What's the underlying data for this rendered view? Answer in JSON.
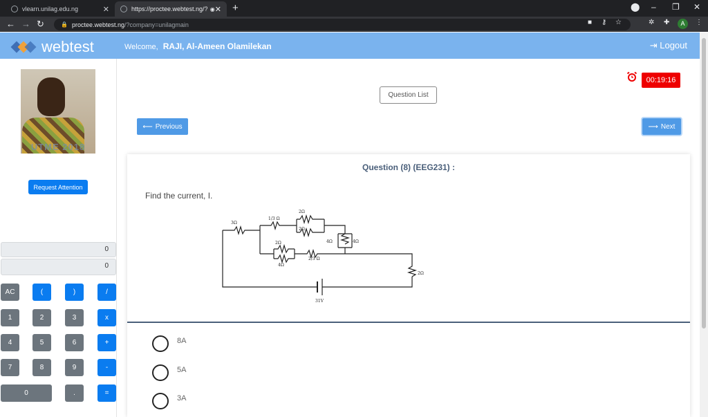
{
  "browser": {
    "tabs": [
      {
        "title": "vlearn.unilag.edu.ng",
        "active": false
      },
      {
        "title": "https://proctee.webtest.ng/?",
        "active": true
      }
    ],
    "url_host": "proctee.webtest.ng",
    "url_path": "/?company=unilagmain",
    "profile_initial": "A"
  },
  "header": {
    "brand": "webtest",
    "welcome_label": "Welcome,",
    "user_name": "RAJI, Al-Ameen Olamilekan",
    "logout_label": "Logout",
    "accent_color": "#7ab3ee"
  },
  "sidebar": {
    "photo_stamp": "UTME 2018",
    "request_attention_label": "Request Attention",
    "calculator": {
      "display_top": "0",
      "display_bottom": "0",
      "keys": {
        "ac": "AC",
        "lparen": "(",
        "rparen": ")",
        "divide": "/",
        "k1": "1",
        "k2": "2",
        "k3": "3",
        "multiply": "x",
        "k4": "4",
        "k5": "5",
        "k6": "6",
        "plus": "+",
        "k7": "7",
        "k8": "8",
        "k9": "9",
        "minus": "-",
        "k0": "0",
        "dot": ".",
        "equals": "="
      }
    }
  },
  "exam": {
    "timer": "00:19:16",
    "question_list_label": "Question List",
    "previous_label": "Previous",
    "next_label": "Next",
    "question_title": "Question (8) (EEG231) :",
    "question_text": "Find the current, I.",
    "circuit_labels": {
      "r_left": "3Ω",
      "r_third": "1/3 Ω",
      "r_par_top": "2Ω",
      "r_par_bottom": "2Ω",
      "r_4a": "4Ω",
      "r_4b": "4Ω",
      "r_2mid": "2Ω",
      "r_4mid": "4Ω",
      "r_twothird": "2/3 Ω",
      "r_right": "2Ω",
      "source": "31V"
    },
    "options": [
      {
        "label": "8A"
      },
      {
        "label": "5A"
      },
      {
        "label": "3A"
      }
    ]
  }
}
